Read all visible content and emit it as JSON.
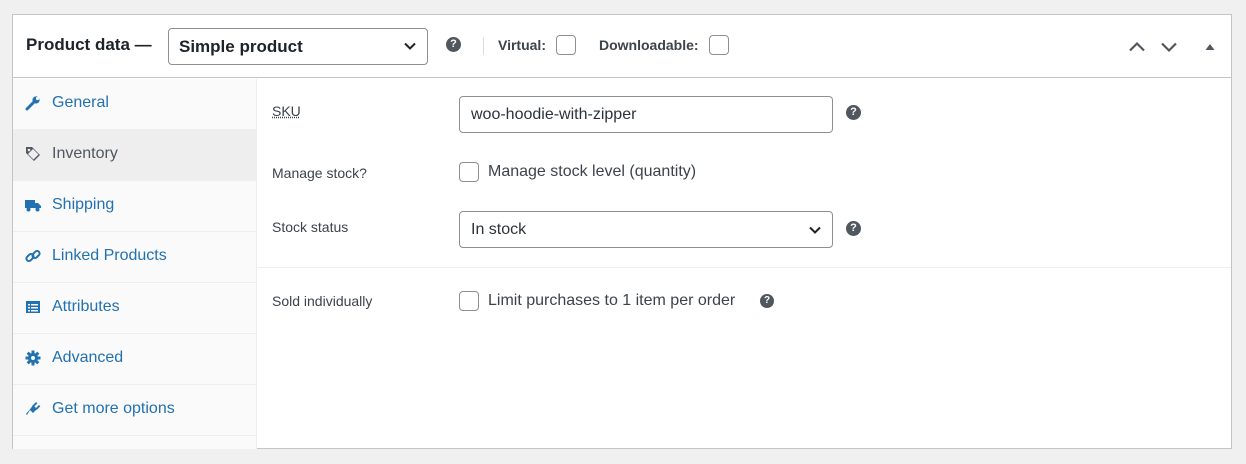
{
  "header": {
    "title": "Product data —",
    "product_type": "Simple product",
    "virtual_label": "Virtual:",
    "downloadable_label": "Downloadable:",
    "virtual_checked": false,
    "downloadable_checked": false,
    "help_glyph": "?",
    "icons": [
      "help-icon",
      "chevron-up-icon",
      "chevron-down-icon",
      "triangle-up-icon"
    ]
  },
  "sidebar": {
    "items": [
      {
        "label": "General",
        "icon": "wrench-icon",
        "active": false
      },
      {
        "label": "Inventory",
        "icon": "tag-icon",
        "active": true
      },
      {
        "label": "Shipping",
        "icon": "truck-icon",
        "active": false
      },
      {
        "label": "Linked Products",
        "icon": "link-icon",
        "active": false
      },
      {
        "label": "Attributes",
        "icon": "list-icon",
        "active": false
      },
      {
        "label": "Advanced",
        "icon": "gear-icon",
        "active": false
      },
      {
        "label": "Get more options",
        "icon": "plug-icon",
        "active": false
      }
    ]
  },
  "inventory": {
    "sku_label": "SKU",
    "sku_value": "woo-hoodie-with-zipper",
    "manage_stock_label": "Manage stock?",
    "manage_stock_text": "Manage stock level (quantity)",
    "manage_stock_checked": false,
    "stock_status_label": "Stock status",
    "stock_status_value": "In stock",
    "sold_individually_label": "Sold individually",
    "sold_individually_text": "Limit purchases to 1 item per order",
    "sold_individually_checked": false
  },
  "colors": {
    "link": "#2271b1",
    "active_tab_bg": "#eeeeee",
    "border": "#c3c4c7",
    "help_icon": "#50575e"
  }
}
